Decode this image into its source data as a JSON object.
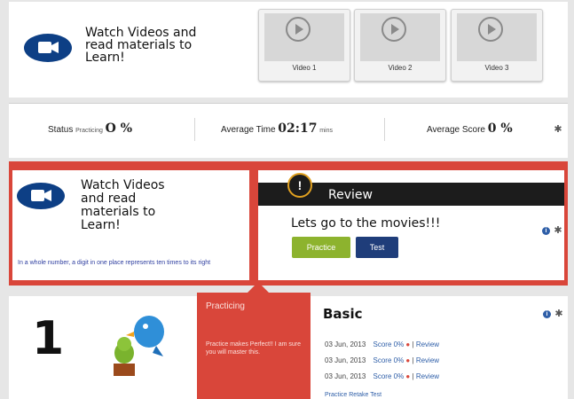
{
  "header": {
    "intro_text": "Watch Videos and read materials to Learn!",
    "videos": [
      {
        "label": "Video 1"
      },
      {
        "label": "Video 2"
      },
      {
        "label": "Video 3"
      }
    ]
  },
  "stats": {
    "status_label": "Status",
    "status_state": "Practicing",
    "status_value": "O %",
    "avg_time_label": "Average Time",
    "avg_time_value": "02:17",
    "avg_time_unit": "mins",
    "avg_score_label": "Average Score",
    "avg_score_value": "0 %"
  },
  "lesson": {
    "intro_text": "Watch Videos and read materials to Learn!",
    "description": "In a whole number, a digit in one place represents ten times to its right",
    "review_title": "Review",
    "review_message": "Lets go to the movies!!!",
    "practice_label": "Practice",
    "test_label": "Test"
  },
  "level": {
    "number": "1",
    "status": "Practicing",
    "encouragement": "Practice makes Perfect!! I am sure you will master this.",
    "title": "Basic",
    "attempts": [
      {
        "date": "03 Jun, 2013",
        "score": "Score 0%",
        "review": "Review"
      },
      {
        "date": "03 Jun, 2013",
        "score": "Score 0%",
        "review": "Review"
      },
      {
        "date": "03 Jun, 2013",
        "score": "Score 0%",
        "review": "Review"
      }
    ],
    "actions": {
      "practice": "Practice",
      "retake": "Retake",
      "test": "Test"
    }
  },
  "colors": {
    "accent_red": "#d9463a",
    "navy": "#1f3d7a",
    "green_button": "#8db32e",
    "icon_blue": "#0d3f85"
  }
}
